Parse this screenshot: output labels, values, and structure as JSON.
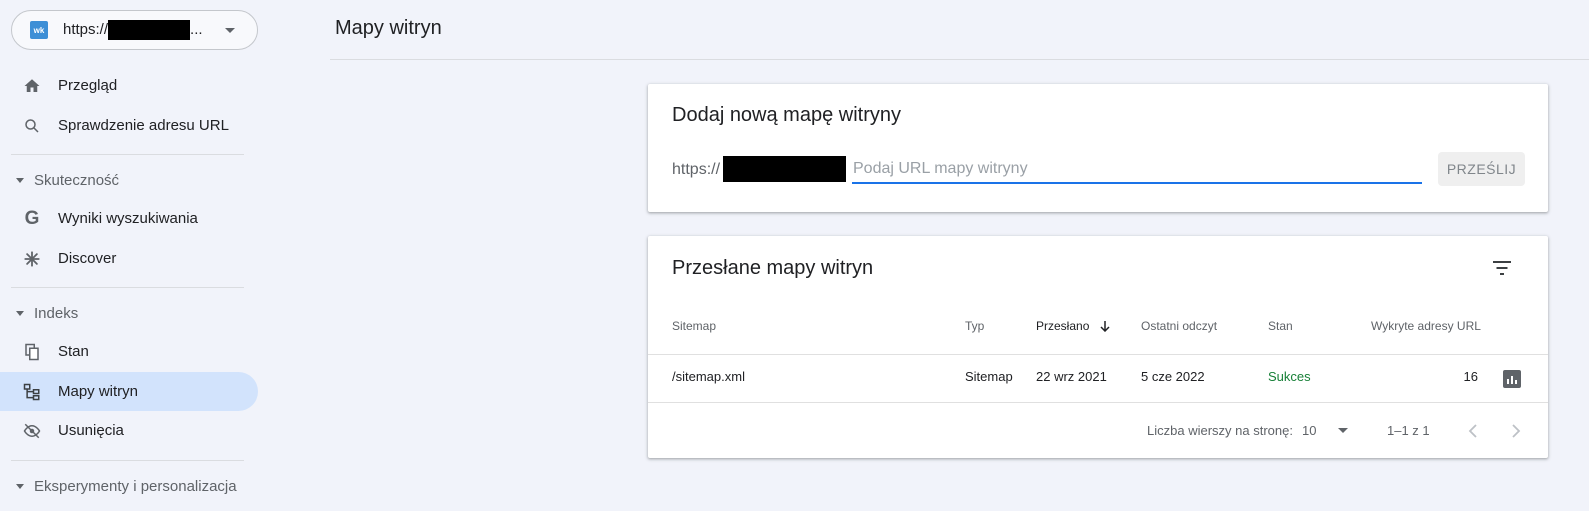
{
  "property": {
    "url_prefix": "https://",
    "url_suffix": "..."
  },
  "nav": {
    "overview": "Przegląd",
    "url_inspection": "Sprawdzenie adresu URL",
    "section_performance": "Skuteczność",
    "search_results": "Wyniki wyszukiwania",
    "discover": "Discover",
    "section_index": "Indeks",
    "coverage": "Stan",
    "sitemaps": "Mapy witryn",
    "removals": "Usunięcia",
    "section_experiments": "Eksperymenty i personalizacja"
  },
  "page": {
    "title": "Mapy witryn"
  },
  "add_sitemap": {
    "title": "Dodaj nową mapę witryny",
    "url_prefix": "https://",
    "placeholder": "Podaj URL mapy witryny",
    "submit_label": "PRZEŚLIJ"
  },
  "submitted": {
    "title": "Przesłane mapy witryn",
    "columns": {
      "sitemap": "Sitemap",
      "type": "Typ",
      "submitted": "Przesłano",
      "last_read": "Ostatni odczyt",
      "status": "Stan",
      "discovered_urls": "Wykryte adresy URL"
    },
    "rows": [
      {
        "sitemap": "/sitemap.xml",
        "type": "Sitemap",
        "submitted": "22 wrz 2021",
        "last_read": "5 cze 2022",
        "status": "Sukces",
        "discovered_urls": "16"
      }
    ],
    "pagination": {
      "rows_per_page_label": "Liczba wierszy na stronę:",
      "rows_per_page": "10",
      "range": "1–1 z 1"
    }
  },
  "colors": {
    "accent": "#1a73e8",
    "active_nav": "#d2e3fc",
    "success": "#188038",
    "background": "#f1f3fa"
  }
}
